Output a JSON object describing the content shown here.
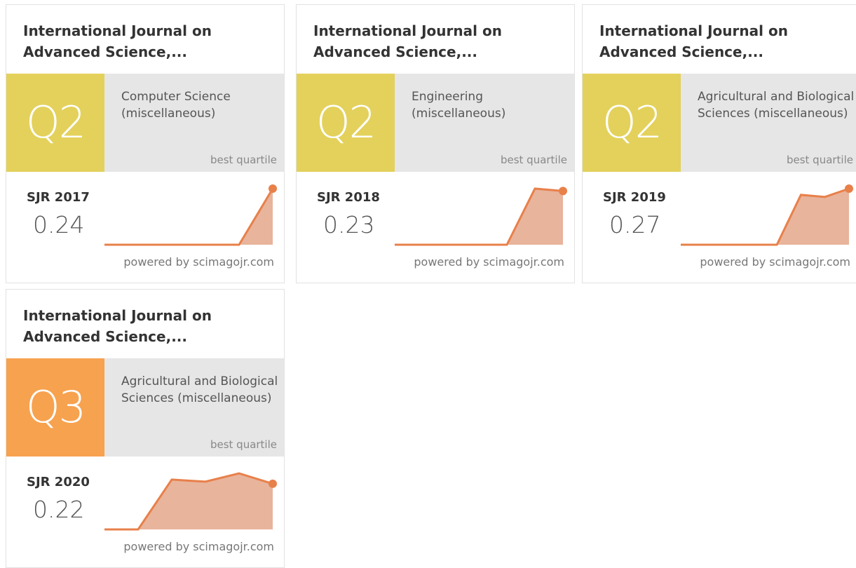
{
  "colors": {
    "q2": "#e3d15b",
    "q3": "#f7a24f",
    "band": "#e6e6e6",
    "line": "#e8804a",
    "fill": "#e8b49c",
    "dot": "#e8804a"
  },
  "cards": [
    {
      "title": "International Journal on Advanced Science,...",
      "quartile": "Q2",
      "quartile_color": "q2",
      "category": "Computer Science (miscellaneous)",
      "best_label": "best quartile",
      "sjr_label": "SJR 2017",
      "sjr_value": "0.24",
      "powered": "powered by scimagojr.com",
      "series": [
        0,
        0,
        0,
        0,
        0,
        0.24
      ]
    },
    {
      "title": "International Journal on Advanced Science,...",
      "quartile": "Q2",
      "quartile_color": "q2",
      "category": "Engineering (miscellaneous)",
      "best_label": "best quartile",
      "sjr_label": "SJR 2018",
      "sjr_value": "0.23",
      "powered": "powered by scimagojr.com",
      "series": [
        0,
        0,
        0,
        0,
        0,
        0.24,
        0.23
      ]
    },
    {
      "title": "International Journal on Advanced Science,...",
      "quartile": "Q2",
      "quartile_color": "q2",
      "category": "Agricultural and Biological Sciences (miscellaneous)",
      "best_label": "best quartile",
      "sjr_label": "SJR 2019",
      "sjr_value": "0.27",
      "powered": "powered by scimagojr.com",
      "series": [
        0,
        0,
        0,
        0,
        0,
        0.24,
        0.23,
        0.27
      ]
    },
    {
      "title": "International Journal on Advanced Science,...",
      "quartile": "Q3",
      "quartile_color": "q3",
      "category": "Agricultural and Biological Sciences (miscellaneous)",
      "best_label": "best quartile",
      "sjr_label": "SJR 2020",
      "sjr_value": "0.22",
      "powered": "powered by scimagojr.com",
      "series": [
        0,
        0,
        0.24,
        0.23,
        0.27,
        0.22
      ]
    }
  ]
}
